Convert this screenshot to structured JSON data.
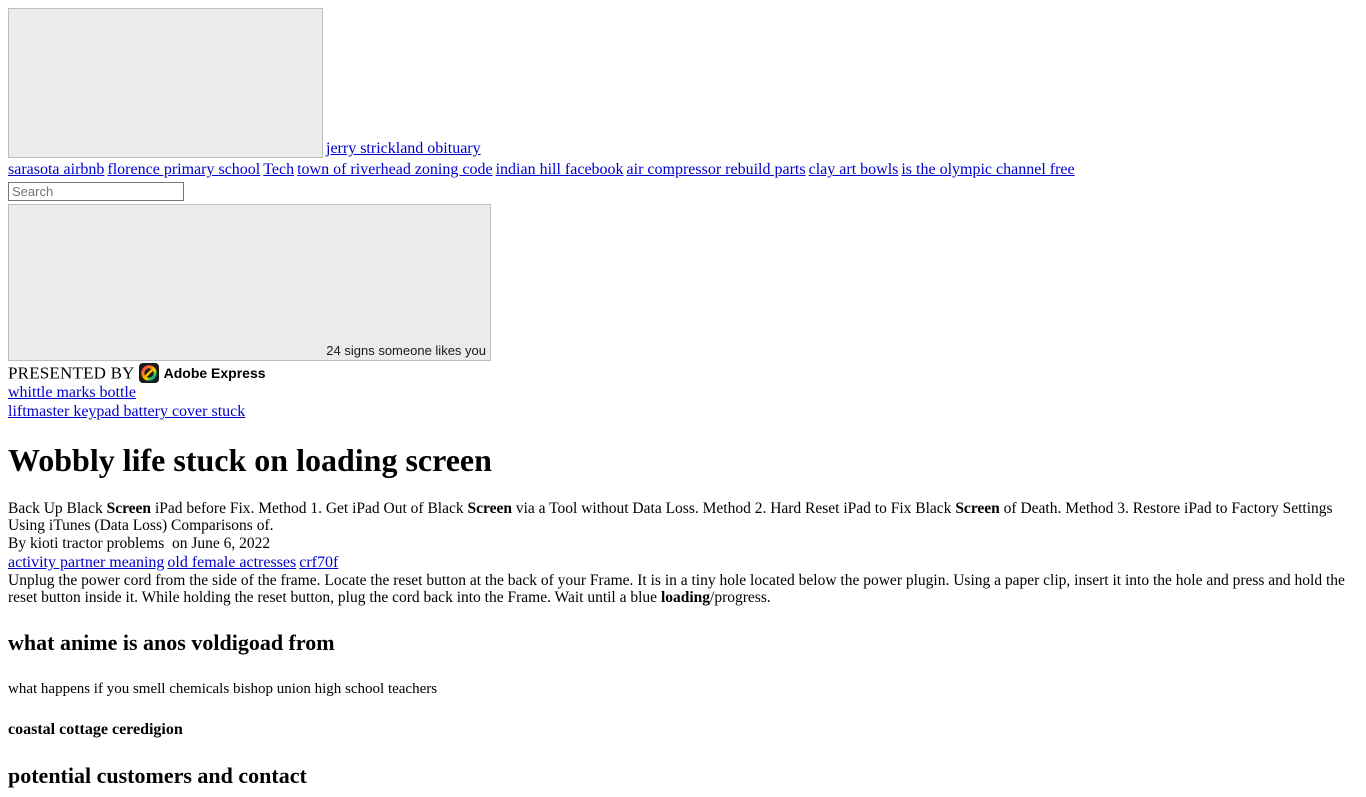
{
  "hero": {
    "image_alt": "",
    "headline_link": "jerry strickland obituary"
  },
  "nav": {
    "items": [
      "sarasota airbnb",
      "florence primary school",
      "Tech",
      "town of riverhead zoning code",
      "indian hill facebook",
      "air compressor rebuild parts",
      "clay art bowls",
      "is the olympic channel free"
    ]
  },
  "search": {
    "value": "",
    "placeholder": "Search"
  },
  "secondary": {
    "image_alt": "24 signs someone likes you"
  },
  "presented": {
    "label": "PRESENTED BY",
    "brand": "Adobe Express"
  },
  "promo_links": [
    "whittle marks bottle",
    "liftmaster keypad battery cover stuck"
  ],
  "article": {
    "title": "Wobbly life stuck on loading screen",
    "summary_parts": [
      {
        "text": "Back Up Black ",
        "bold": false
      },
      {
        "text": "Screen",
        "bold": true
      },
      {
        "text": " iPad before Fix. Method 1. Get iPad Out of Black ",
        "bold": false
      },
      {
        "text": "Screen",
        "bold": true
      },
      {
        "text": " via a Tool without Data Loss. Method 2. Hard Reset iPad to Fix Black ",
        "bold": false
      },
      {
        "text": "Screen",
        "bold": true
      },
      {
        "text": " of Death. Method 3. Restore iPad to Factory Settings Using iTunes (Data Loss) Comparisons of.",
        "bold": false
      }
    ],
    "byline_author": "By kioti tractor problems",
    "byline_date": "on June 6, 2022",
    "tag_links": [
      "activity partner meaning",
      "old female actresses",
      "crf70f"
    ],
    "body_parts": [
      {
        "text": "Unplug the power cord from the side of the frame. Locate the reset button at the back of your Frame. It is in a tiny hole located below the power plugin. Using a paper clip, insert it into the hole and press and hold the reset button inside it. While holding the reset button, plug the cord back into the Frame. Wait until a blue ",
        "bold": false
      },
      {
        "text": "loading",
        "bold": true
      },
      {
        "text": "/progress.",
        "bold": false
      }
    ]
  },
  "sections": [
    {
      "heading": "what anime is anos voldigoad from",
      "text": "what happens if you smell chemicals bishop union high school teachers",
      "subheading": "coastal cottage ceredigion"
    }
  ],
  "clipped_heading": "potential customers and contact"
}
